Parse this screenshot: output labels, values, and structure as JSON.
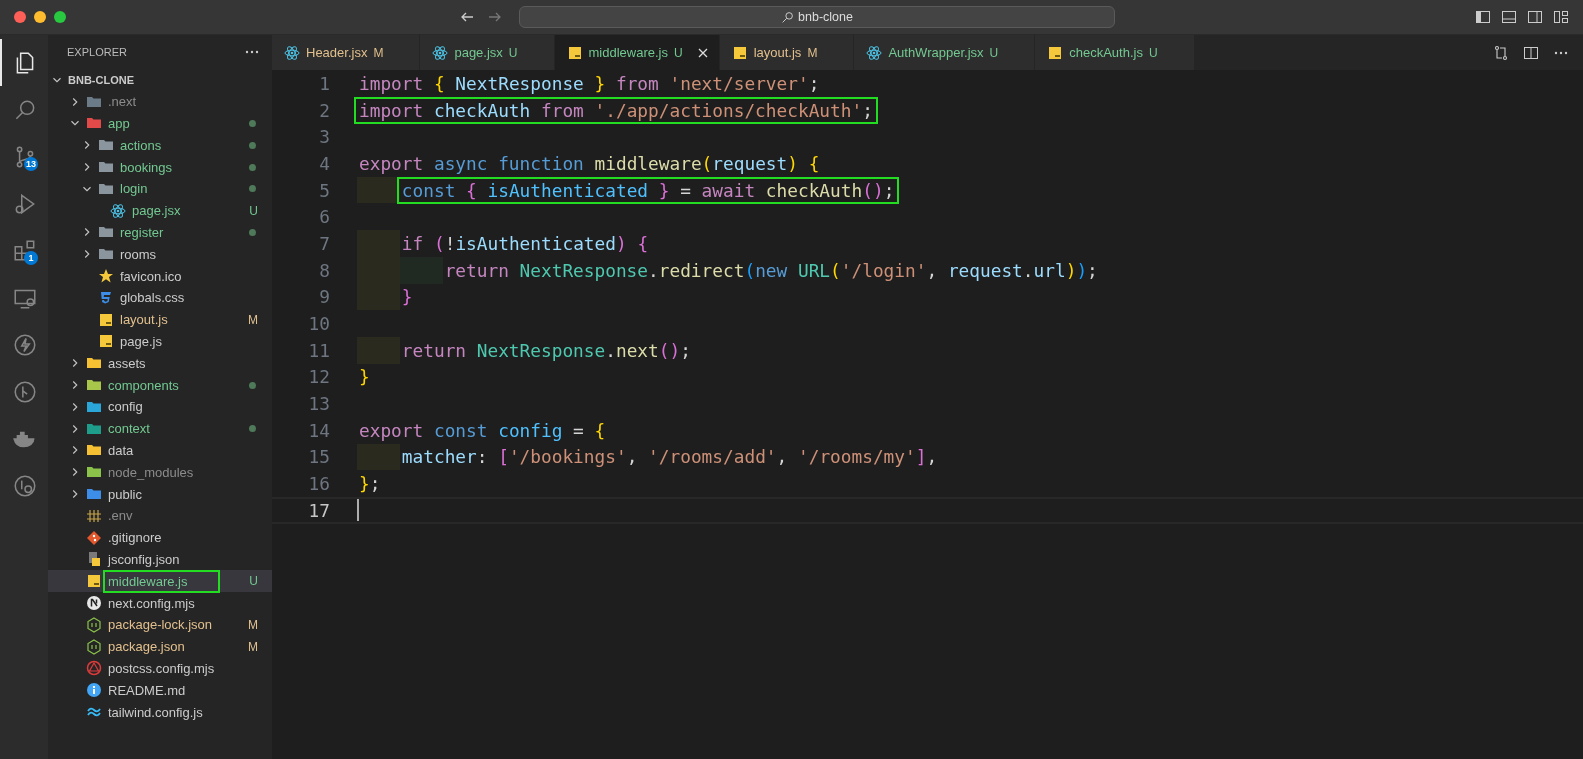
{
  "window": {
    "search": "bnb-clone"
  },
  "activity_bar": [
    {
      "kind": "files",
      "selected": true
    },
    {
      "kind": "search",
      "selected": false
    },
    {
      "kind": "source-control",
      "selected": false,
      "badge": "13"
    },
    {
      "kind": "run-debug",
      "selected": false
    },
    {
      "kind": "extensions",
      "selected": false,
      "badge": "1"
    },
    {
      "kind": "remote",
      "selected": false
    },
    {
      "kind": "lightning",
      "selected": false
    },
    {
      "kind": "git-graph",
      "selected": false
    },
    {
      "kind": "docker",
      "selected": false
    },
    {
      "kind": "git-history",
      "selected": false
    }
  ],
  "explorer": {
    "title": "EXPLORER",
    "root": {
      "name": "BNB-CLONE",
      "expanded": true,
      "children": [
        {
          "name": ".next",
          "kind": "folder-next",
          "expanded": false,
          "color": "#8c8c8c",
          "dot": false,
          "selected": false
        },
        {
          "name": "app",
          "kind": "folder-app",
          "expanded": true,
          "color": "#73c991",
          "dot": true,
          "selected": false,
          "children": [
            {
              "name": "actions",
              "kind": "folder",
              "expanded": false,
              "color": "#73c991",
              "dot": true,
              "selected": false
            },
            {
              "name": "bookings",
              "kind": "folder",
              "expanded": false,
              "color": "#73c991",
              "dot": true,
              "selected": false
            },
            {
              "name": "login",
              "kind": "folder",
              "expanded": true,
              "color": "#73c991",
              "dot": true,
              "selected": false,
              "children": [
                {
                  "name": "page.jsx",
                  "kind": "react",
                  "color": "#73c991",
                  "badge": "U",
                  "dot": false,
                  "selected": false
                }
              ]
            },
            {
              "name": "register",
              "kind": "folder",
              "expanded": false,
              "color": "#73c991",
              "dot": true,
              "selected": false
            },
            {
              "name": "rooms",
              "kind": "folder",
              "expanded": false,
              "color": "#cccccc",
              "dot": false,
              "selected": false
            },
            {
              "name": "favicon.ico",
              "kind": "star",
              "color": "#cccccc",
              "dot": false,
              "selected": false
            },
            {
              "name": "globals.css",
              "kind": "css",
              "color": "#cccccc",
              "dot": false,
              "selected": false
            },
            {
              "name": "layout.js",
              "kind": "js",
              "color": "#e2c08d",
              "badge": "M",
              "dot": false,
              "selected": false
            },
            {
              "name": "page.js",
              "kind": "js",
              "color": "#cccccc",
              "dot": false,
              "selected": false
            }
          ]
        },
        {
          "name": "assets",
          "kind": "folder-assets",
          "expanded": false,
          "color": "#cccccc",
          "dot": false,
          "selected": false
        },
        {
          "name": "components",
          "kind": "folder-components",
          "expanded": false,
          "color": "#73c991",
          "dot": true,
          "selected": false
        },
        {
          "name": "config",
          "kind": "folder-config",
          "expanded": false,
          "color": "#cccccc",
          "dot": false,
          "selected": false
        },
        {
          "name": "context",
          "kind": "folder-context",
          "expanded": false,
          "color": "#73c991",
          "dot": true,
          "selected": false
        },
        {
          "name": "data",
          "kind": "folder-data",
          "expanded": false,
          "color": "#cccccc",
          "dot": false,
          "selected": false
        },
        {
          "name": "node_modules",
          "kind": "folder-node",
          "expanded": false,
          "color": "#8c8c8c",
          "dot": false,
          "selected": false
        },
        {
          "name": "public",
          "kind": "folder-public",
          "expanded": false,
          "color": "#cccccc",
          "dot": false,
          "selected": false
        },
        {
          "name": ".env",
          "kind": "env",
          "color": "#8c8c8c",
          "dot": false,
          "selected": false
        },
        {
          "name": ".gitignore",
          "kind": "git",
          "color": "#cccccc",
          "dot": false,
          "selected": false
        },
        {
          "name": "jsconfig.json",
          "kind": "jsconfig",
          "color": "#cccccc",
          "dot": false,
          "selected": false
        },
        {
          "name": "middleware.js",
          "kind": "js",
          "color": "#73c991",
          "badge": "U",
          "dot": false,
          "selected": true,
          "boxed": true
        },
        {
          "name": "next.config.mjs",
          "kind": "next",
          "color": "#cccccc",
          "dot": false,
          "selected": false
        },
        {
          "name": "package-lock.json",
          "kind": "json",
          "color": "#e2c08d",
          "badge": "M",
          "dot": false,
          "selected": false
        },
        {
          "name": "package.json",
          "kind": "json",
          "color": "#e2c08d",
          "badge": "M",
          "dot": false,
          "selected": false
        },
        {
          "name": "postcss.config.mjs",
          "kind": "postcss",
          "color": "#cccccc",
          "dot": false,
          "selected": false
        },
        {
          "name": "README.md",
          "kind": "info",
          "color": "#cccccc",
          "dot": false,
          "selected": false
        },
        {
          "name": "tailwind.config.js",
          "kind": "tailwind",
          "color": "#cccccc",
          "dot": false,
          "selected": false
        }
      ]
    }
  },
  "tabs": [
    {
      "label": "Header.jsx",
      "kind": "react",
      "color": "#e2c08d",
      "badge": "M",
      "selected": false
    },
    {
      "label": "page.jsx",
      "kind": "react",
      "color": "#73c991",
      "badge": "U",
      "selected": false
    },
    {
      "label": "middleware.js",
      "kind": "js",
      "color": "#73c991",
      "badge": "U",
      "selected": true
    },
    {
      "label": "layout.js",
      "kind": "js",
      "color": "#e2c08d",
      "badge": "M",
      "selected": false
    },
    {
      "label": "AuthWrapper.jsx",
      "kind": "react",
      "color": "#73c991",
      "badge": "U",
      "selected": false
    },
    {
      "label": "checkAuth.js",
      "kind": "js",
      "color": "#73c991",
      "badge": "U",
      "selected": false
    }
  ],
  "editor": {
    "lines": [
      {
        "number": "1",
        "tokens": [
          {
            "kind": "kw",
            "text": "import "
          },
          {
            "kind": "b1",
            "text": "{ "
          },
          {
            "kind": "var",
            "text": "NextResponse "
          },
          {
            "kind": "b1",
            "text": "} "
          },
          {
            "kind": "kw",
            "text": "from "
          },
          {
            "kind": "str",
            "text": "'next/server'"
          },
          {
            "kind": "p",
            "text": ";"
          }
        ]
      },
      {
        "number": "2",
        "boxed": true,
        "tokens": [
          {
            "kind": "kw",
            "text": "import "
          },
          {
            "kind": "var",
            "text": "checkAuth "
          },
          {
            "kind": "kw",
            "text": "from "
          },
          {
            "kind": "str",
            "text": "'./app/actions/checkAuth'"
          },
          {
            "kind": "p",
            "text": ";"
          }
        ]
      },
      {
        "number": "3"
      },
      {
        "number": "4",
        "tokens": [
          {
            "kind": "kw",
            "text": "export "
          },
          {
            "kind": "st",
            "text": "async function "
          },
          {
            "kind": "fn",
            "text": "middleware"
          },
          {
            "kind": "b1",
            "text": "("
          },
          {
            "kind": "var",
            "text": "request"
          },
          {
            "kind": "b1",
            "text": ") {"
          }
        ]
      },
      {
        "number": "5",
        "boxed": true,
        "tokens": [
          {
            "kind": "indent"
          },
          {
            "kind": "st",
            "text": "const "
          },
          {
            "kind": "b2",
            "text": "{ "
          },
          {
            "kind": "const",
            "text": "isAuthenticated "
          },
          {
            "kind": "b2",
            "text": "} "
          },
          {
            "kind": "p",
            "text": "= "
          },
          {
            "kind": "kw",
            "text": "await "
          },
          {
            "kind": "fn",
            "text": "checkAuth"
          },
          {
            "kind": "b2",
            "text": "()"
          },
          {
            "kind": "p",
            "text": ";"
          }
        ]
      },
      {
        "number": "6"
      },
      {
        "number": "7",
        "tokens": [
          {
            "kind": "indent"
          },
          {
            "kind": "kw",
            "text": "if "
          },
          {
            "kind": "b2",
            "text": "("
          },
          {
            "kind": "p",
            "text": "!"
          },
          {
            "kind": "var",
            "text": "isAuthenticated"
          },
          {
            "kind": "b2",
            "text": ") {"
          }
        ]
      },
      {
        "number": "8",
        "tokens": [
          {
            "kind": "indent"
          },
          {
            "kind": "indent"
          },
          {
            "kind": "kw",
            "text": "return "
          },
          {
            "kind": "cls",
            "text": "NextResponse"
          },
          {
            "kind": "p",
            "text": "."
          },
          {
            "kind": "fn",
            "text": "redirect"
          },
          {
            "kind": "b3",
            "text": "("
          },
          {
            "kind": "st",
            "text": "new "
          },
          {
            "kind": "cls",
            "text": "URL"
          },
          {
            "kind": "b1",
            "text": "("
          },
          {
            "kind": "str",
            "text": "'/login'"
          },
          {
            "kind": "p",
            "text": ", "
          },
          {
            "kind": "var",
            "text": "request"
          },
          {
            "kind": "p",
            "text": "."
          },
          {
            "kind": "var",
            "text": "url"
          },
          {
            "kind": "b1",
            "text": ")"
          },
          {
            "kind": "b3",
            "text": ")"
          },
          {
            "kind": "p",
            "text": ";"
          }
        ]
      },
      {
        "number": "9",
        "tokens": [
          {
            "kind": "indent"
          },
          {
            "kind": "b2",
            "text": "}"
          }
        ]
      },
      {
        "number": "10"
      },
      {
        "number": "11",
        "tokens": [
          {
            "kind": "indent"
          },
          {
            "kind": "kw",
            "text": "return "
          },
          {
            "kind": "cls",
            "text": "NextResponse"
          },
          {
            "kind": "p",
            "text": "."
          },
          {
            "kind": "fn",
            "text": "next"
          },
          {
            "kind": "b2",
            "text": "()"
          },
          {
            "kind": "p",
            "text": ";"
          }
        ]
      },
      {
        "number": "12",
        "tokens": [
          {
            "kind": "b1",
            "text": "}"
          }
        ]
      },
      {
        "number": "13"
      },
      {
        "number": "14",
        "tokens": [
          {
            "kind": "kw",
            "text": "export "
          },
          {
            "kind": "st",
            "text": "const "
          },
          {
            "kind": "const",
            "text": "config "
          },
          {
            "kind": "p",
            "text": "= "
          },
          {
            "kind": "b1",
            "text": "{"
          }
        ]
      },
      {
        "number": "15",
        "tokens": [
          {
            "kind": "indent"
          },
          {
            "kind": "var",
            "text": "matcher"
          },
          {
            "kind": "p",
            "text": ": "
          },
          {
            "kind": "b2",
            "text": "["
          },
          {
            "kind": "str",
            "text": "'/bookings'"
          },
          {
            "kind": "p",
            "text": ", "
          },
          {
            "kind": "str",
            "text": "'/rooms/add'"
          },
          {
            "kind": "p",
            "text": ", "
          },
          {
            "kind": "str",
            "text": "'/rooms/my'"
          },
          {
            "kind": "b2",
            "text": "]"
          },
          {
            "kind": "p",
            "text": ","
          }
        ]
      },
      {
        "number": "16",
        "tokens": [
          {
            "kind": "b1",
            "text": "}"
          },
          {
            "kind": "p",
            "text": ";"
          }
        ]
      },
      {
        "number": "17",
        "current": true
      }
    ]
  }
}
